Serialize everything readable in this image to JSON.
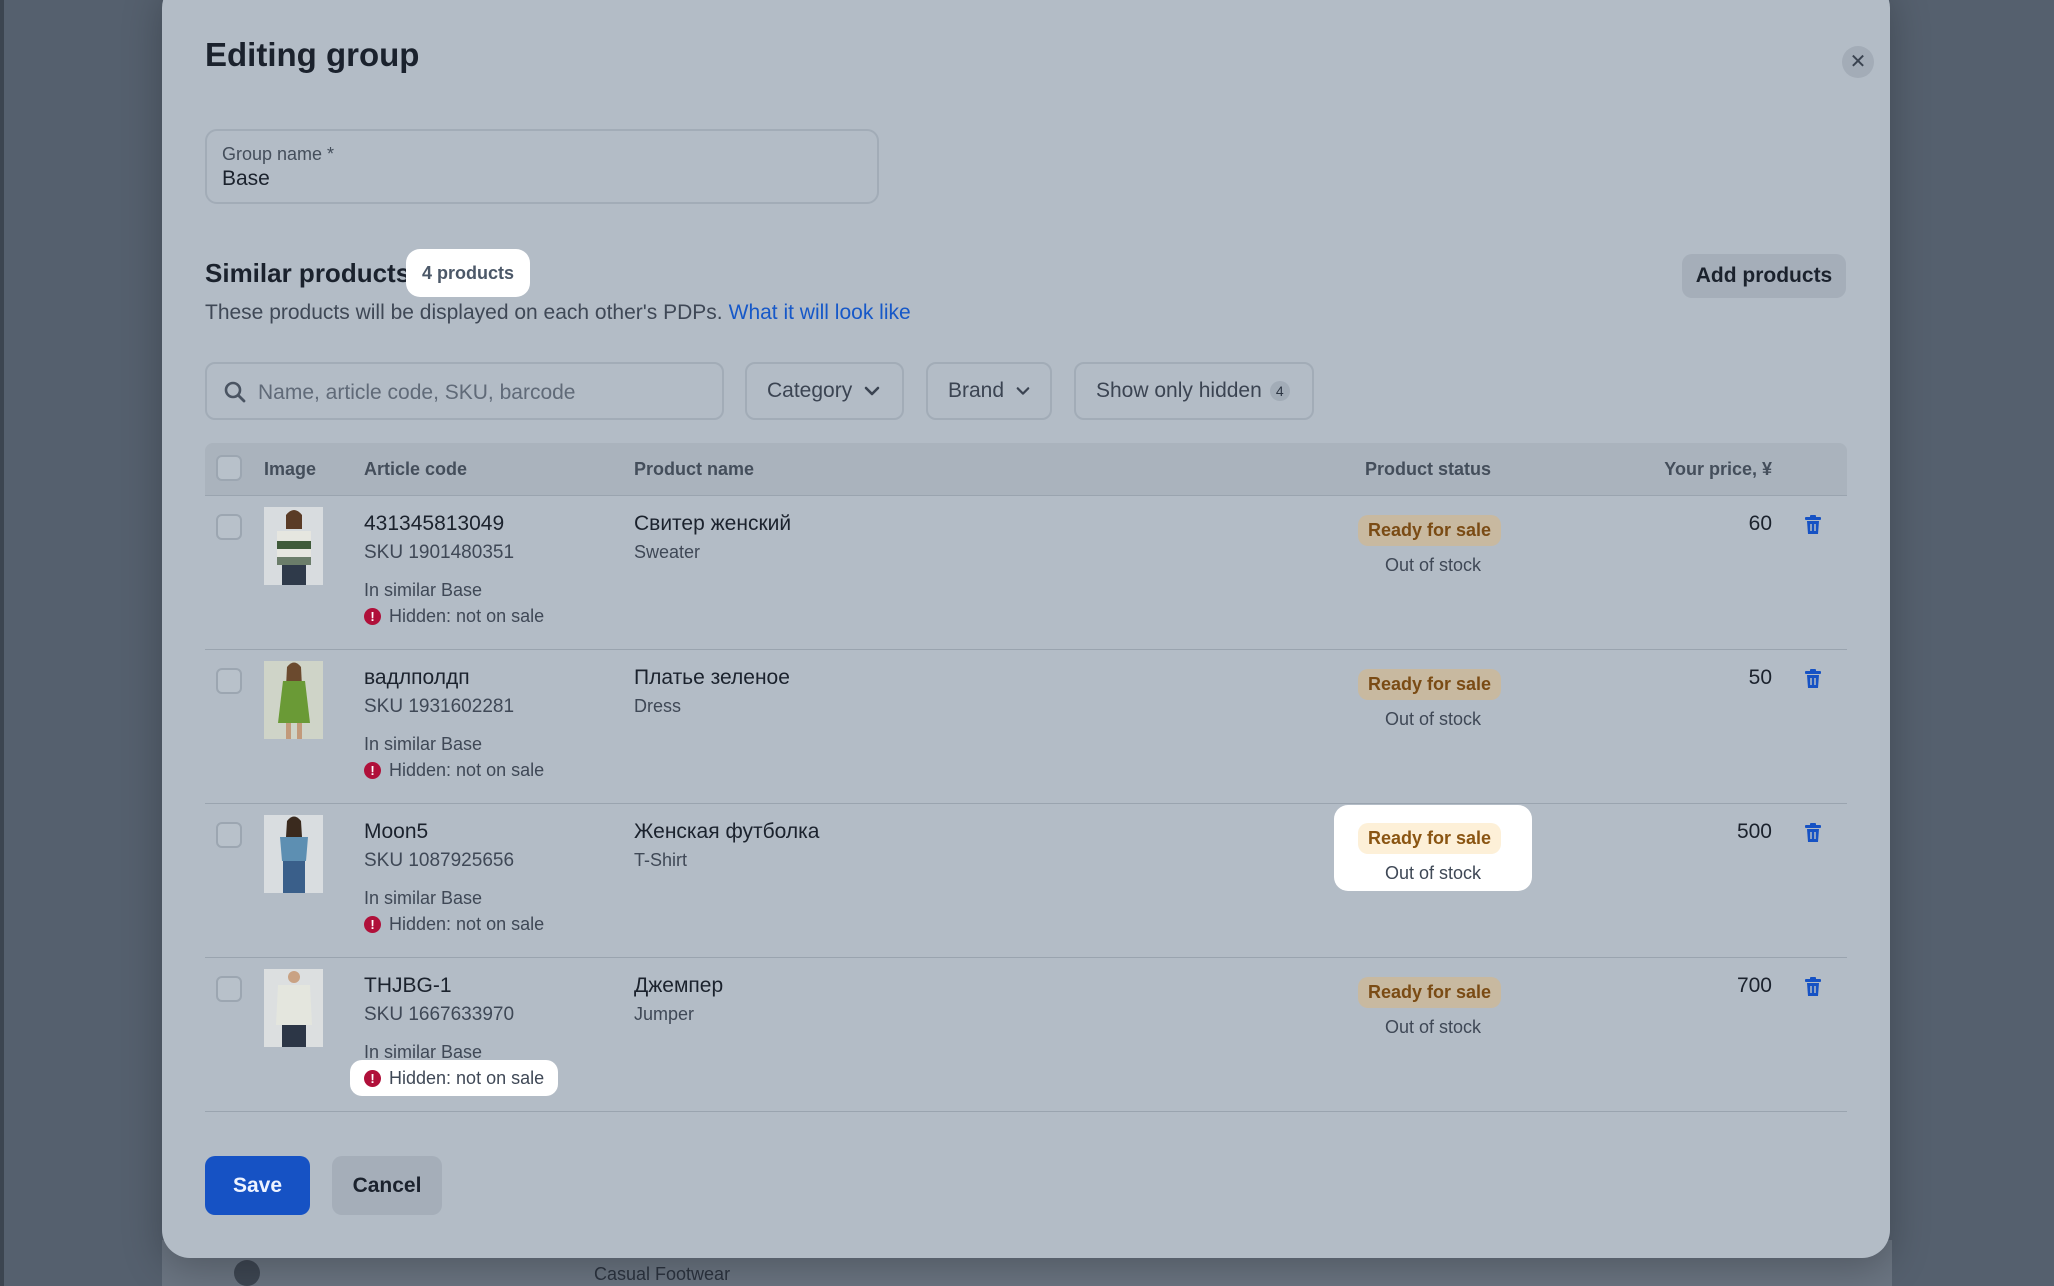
{
  "modal": {
    "title": "Editing group",
    "close_icon": "close-icon"
  },
  "group_name": {
    "label": "Group name *",
    "value": "Base"
  },
  "similar": {
    "title": "Similar products",
    "count": "4 products",
    "description": "These products will be displayed on each other's PDPs.",
    "link": "What it will look like",
    "add_button": "Add products"
  },
  "filters": {
    "search_placeholder": "Name, article code, SKU, barcode",
    "category": "Category",
    "brand": "Brand",
    "show_hidden": "Show only hidden",
    "show_hidden_count": "4"
  },
  "table": {
    "headers": {
      "image": "Image",
      "article": "Article code",
      "product": "Product name",
      "status": "Product status",
      "price": "Your price, ¥"
    },
    "rows": [
      {
        "article": "431345813049",
        "sku": "SKU 1901480351",
        "in_similar": "In similar Base",
        "hidden": "Hidden: not on sale",
        "name": "Свитер женский",
        "type": "Sweater",
        "status": "Ready for sale",
        "stock": "Out of stock",
        "price": "60"
      },
      {
        "article": "вадлполдп",
        "sku": "SKU 1931602281",
        "in_similar": "In similar Base",
        "hidden": "Hidden: not on sale",
        "name": "Платье зеленое",
        "type": "Dress",
        "status": "Ready for sale",
        "stock": "Out of stock",
        "price": "50"
      },
      {
        "article": "Moon5",
        "sku": "SKU 1087925656",
        "in_similar": "In similar Base",
        "hidden": "Hidden: not on sale",
        "name": "Женская футболка",
        "type": "T-Shirt",
        "status": "Ready for sale",
        "stock": "Out of stock",
        "price": "500"
      },
      {
        "article": "THJBG-1",
        "sku": "SKU 1667633970",
        "in_similar": "In similar Base",
        "hidden": "Hidden: not on sale",
        "name": "Джемпер",
        "type": "Jumper",
        "status": "Ready for sale",
        "stock": "Out of stock",
        "price": "700"
      }
    ]
  },
  "actions": {
    "save": "Save",
    "cancel": "Cancel"
  },
  "backdrop": {
    "row_text": "Casual Footwear"
  },
  "colors": {
    "primary": "#1652c4",
    "link": "#1658c8",
    "status_text": "#8a5512",
    "warning": "#b0103a"
  }
}
